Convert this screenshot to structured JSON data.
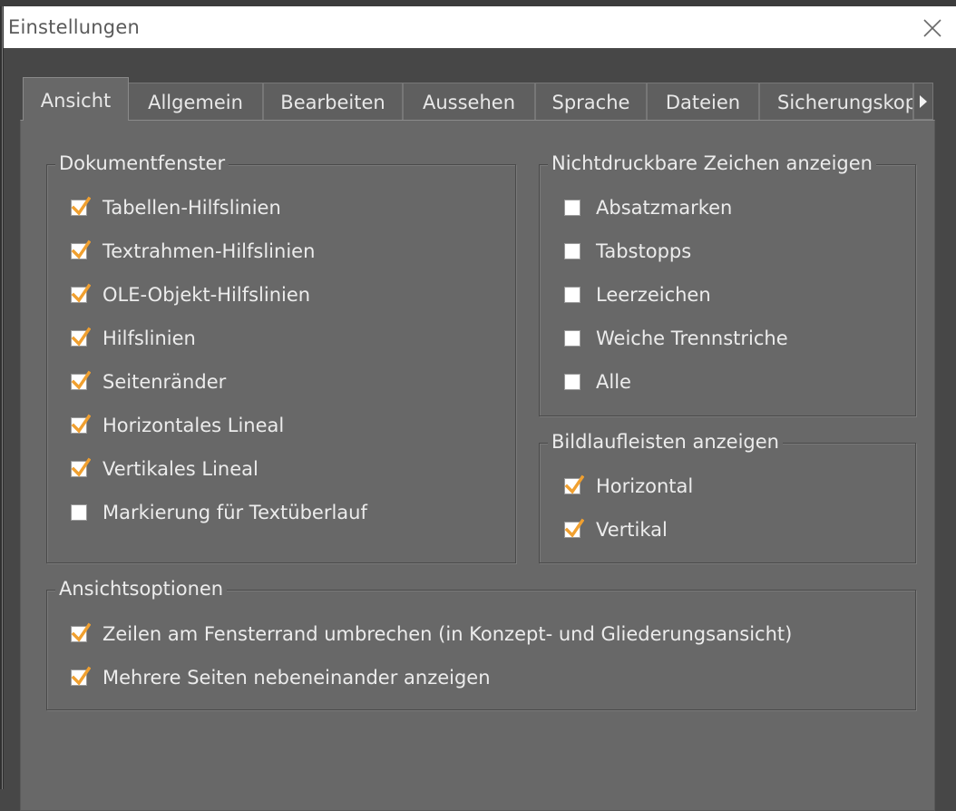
{
  "window": {
    "title": "Einstellungen"
  },
  "tabs": [
    {
      "label": "Ansicht",
      "active": true
    },
    {
      "label": "Allgemein"
    },
    {
      "label": "Bearbeiten"
    },
    {
      "label": "Aussehen"
    },
    {
      "label": "Sprache"
    },
    {
      "label": "Dateien"
    },
    {
      "label": "Sicherungskopie"
    }
  ],
  "groups": {
    "dokumentfenster": {
      "legend": "Dokumentfenster",
      "options": [
        {
          "label": "Tabellen-Hilfslinien",
          "checked": true
        },
        {
          "label": "Textrahmen-Hilfslinien",
          "checked": true
        },
        {
          "label": "OLE-Objekt-Hilfslinien",
          "checked": true
        },
        {
          "label": "Hilfslinien",
          "checked": true
        },
        {
          "label": "Seitenränder",
          "checked": true
        },
        {
          "label": "Horizontales Lineal",
          "checked": true
        },
        {
          "label": "Vertikales Lineal",
          "checked": true
        },
        {
          "label": "Markierung für Textüberlauf",
          "checked": false
        }
      ]
    },
    "nichtdruckbare": {
      "legend": "Nichtdruckbare Zeichen anzeigen",
      "options": [
        {
          "label": "Absatzmarken",
          "checked": false
        },
        {
          "label": "Tabstopps",
          "checked": false
        },
        {
          "label": "Leerzeichen",
          "checked": false
        },
        {
          "label": "Weiche Trennstriche",
          "checked": false
        },
        {
          "label": "Alle",
          "checked": false
        }
      ]
    },
    "bildlaufleisten": {
      "legend": "Bildlaufleisten anzeigen",
      "options": [
        {
          "label": "Horizontal",
          "checked": true
        },
        {
          "label": "Vertikal",
          "checked": true
        }
      ]
    },
    "ansichtsoptionen": {
      "legend": "Ansichtsoptionen",
      "options": [
        {
          "label": "Zeilen am Fensterrand umbrechen (in Konzept- und Gliederungsansicht)",
          "checked": true
        },
        {
          "label": "Mehrere Seiten nebeneinander anzeigen",
          "checked": true
        }
      ]
    }
  },
  "colors": {
    "check": "#f0a030",
    "panel": "#686868",
    "titlebar": "#ffffff"
  },
  "icons": {
    "close": "close-icon",
    "tab_scroll": "chevron-right-icon",
    "check": "checkmark-icon"
  }
}
